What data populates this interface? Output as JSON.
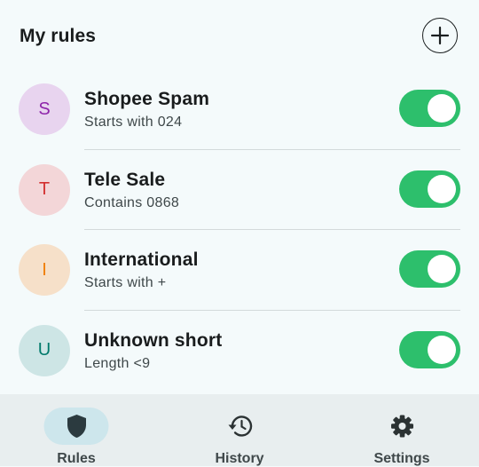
{
  "header": {
    "title": "My rules",
    "add_icon": "plus-icon"
  },
  "rules": [
    {
      "initial": "S",
      "title": "Shopee Spam",
      "subtitle": "Starts with 024",
      "enabled": true,
      "avatar_bg": "#e8d4ef",
      "avatar_fg": "#8e24aa"
    },
    {
      "initial": "T",
      "title": "Tele Sale",
      "subtitle": "Contains 0868",
      "enabled": true,
      "avatar_bg": "#f3d6d8",
      "avatar_fg": "#d32f2f"
    },
    {
      "initial": "I",
      "title": "International",
      "subtitle": "Starts with +",
      "enabled": true,
      "avatar_bg": "#f6e0c9",
      "avatar_fg": "#ef7d00"
    },
    {
      "initial": "U",
      "title": "Unknown short",
      "subtitle": "Length <9",
      "enabled": true,
      "avatar_bg": "#cde5e5",
      "avatar_fg": "#00796b"
    }
  ],
  "nav": {
    "items": [
      {
        "label": "Rules",
        "icon": "shield-icon",
        "active": true
      },
      {
        "label": "History",
        "icon": "history-icon",
        "active": false
      },
      {
        "label": "Settings",
        "icon": "gear-icon",
        "active": false
      }
    ]
  },
  "colors": {
    "toggle_on": "#2dbf6c",
    "toggle_off": "#c3c7c8",
    "nav_active_pill": "#cde6ec",
    "nav_icon": "#2b3233"
  }
}
